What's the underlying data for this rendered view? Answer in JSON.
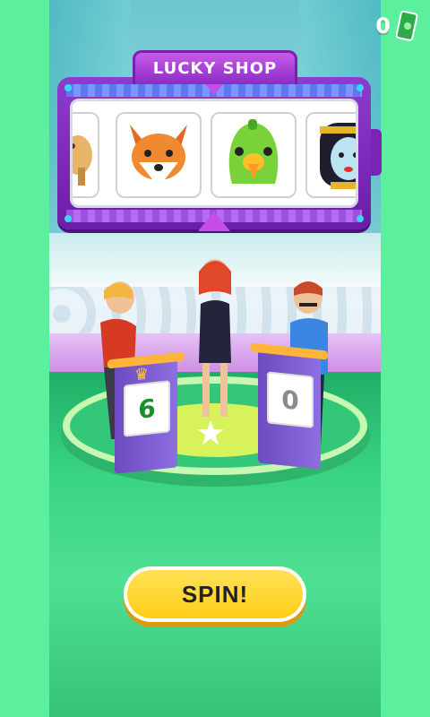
{
  "hud": {
    "cash_count": "0",
    "cash_icon": "cash-bill-icon"
  },
  "shop": {
    "title": "LUCKY SHOP",
    "items": [
      {
        "name": "giraffe"
      },
      {
        "name": "fox"
      },
      {
        "name": "parrot"
      },
      {
        "name": "cleopatra"
      }
    ]
  },
  "podiums": [
    {
      "player": "left-contestant",
      "score": "6",
      "leader": true
    },
    {
      "player": "right-contestant",
      "score": "0",
      "leader": false
    }
  ],
  "spin_button": {
    "label": "SPIN!"
  },
  "colors": {
    "background": "#5cf09e",
    "panel": "#8e3cd0",
    "button": "#ffd22a"
  }
}
